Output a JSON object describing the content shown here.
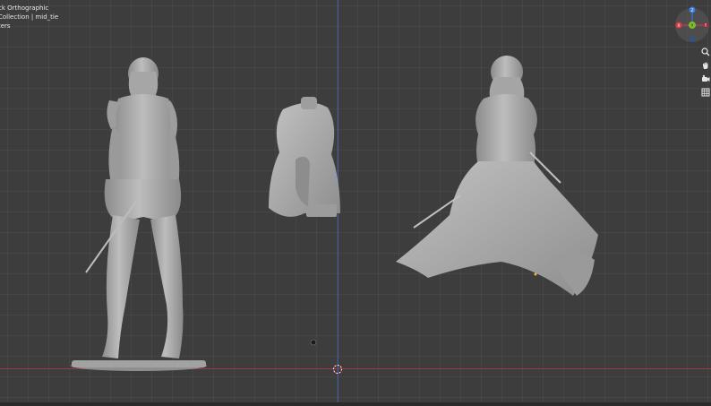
{
  "viewport": {
    "view_name": "ck Orthographic",
    "collection_info": "Collection | mid_tie",
    "units_info": "ters"
  },
  "gizmo": {
    "axes": {
      "pos_z": "Z",
      "neg_x": "X",
      "pos_x": "X",
      "center": "Y"
    },
    "colors": {
      "x": "#e0384a",
      "y": "#7fbf2a",
      "z": "#3c7be0",
      "bg": "#5b5b5b"
    }
  },
  "nav_icons": [
    "zoom-icon",
    "hand-pan-icon",
    "camera-icon",
    "grid-icon"
  ],
  "colors": {
    "viewport_bg": "#3d3d3d",
    "x_axis_line": "#9c3b46",
    "z_axis_line": "#3d5fa8",
    "model": "#a9a9a9"
  }
}
